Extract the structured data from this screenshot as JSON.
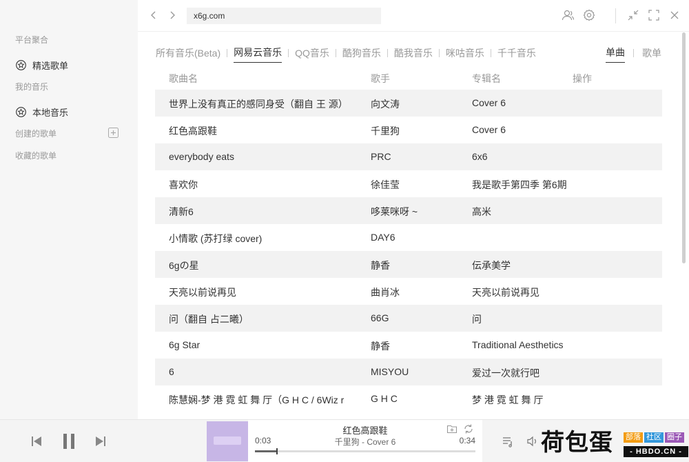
{
  "sidebar": {
    "platform_label": "平台聚合",
    "featured_label": "精选歌单",
    "my_music_label": "我的音乐",
    "local_label": "本地音乐",
    "created_label": "创建的歌单",
    "collected_label": "收藏的歌单"
  },
  "topbar": {
    "address": "x6g.com"
  },
  "tabs": [
    "所有音乐(Beta)",
    "网易云音乐",
    "QQ音乐",
    "酷狗音乐",
    "酷我音乐",
    "咪咕音乐",
    "千千音乐"
  ],
  "active_tab": "网易云音乐",
  "right_tabs": [
    "单曲",
    "歌单"
  ],
  "table": {
    "headers": {
      "name": "歌曲名",
      "artist": "歌手",
      "album": "专辑名",
      "action": "操作"
    },
    "rows": [
      {
        "name": "世界上没有真正的感同身受（翻自 王 源）",
        "artist": "向文涛",
        "album": "Cover 6"
      },
      {
        "name": "红色高跟鞋",
        "artist": "千里狗",
        "album": "Cover 6"
      },
      {
        "name": "everybody eats",
        "artist": "PRC",
        "album": "6x6"
      },
      {
        "name": "喜欢你",
        "artist": "徐佳莹",
        "album": "我是歌手第四季 第6期"
      },
      {
        "name": "清新6",
        "artist": "哆莱咪呀 ~",
        "album": "高米"
      },
      {
        "name": "小情歌 (苏打绿 cover)",
        "artist": "DAY6",
        "album": ""
      },
      {
        "name": "6gの星",
        "artist": "静香",
        "album": "伝承美学"
      },
      {
        "name": "天亮以前说再见",
        "artist": "曲肖冰",
        "album": "天亮以前说再见"
      },
      {
        "name": "问（翻自 占二曦）",
        "artist": "66G",
        "album": "问"
      },
      {
        "name": "6g Star",
        "artist": "静香",
        "album": "Traditional Aesthetics"
      },
      {
        "name": "6",
        "artist": "MISYOU",
        "album": "爱过一次就行吧"
      },
      {
        "name": "陈慧娴-梦 港 霓 虹 舞 厅（G H C / 6Wiz r",
        "artist": "G H C",
        "album": "梦 港 霓 虹 舞 厅"
      }
    ]
  },
  "player": {
    "title": "红色高跟鞋",
    "subtitle": "千里狗 - Cover 6",
    "current_time": "0:03",
    "total_time": "0:34",
    "progress_fraction": 0.1
  },
  "watermark": {
    "brand": "荷包蛋",
    "tags": [
      "部落",
      "社区",
      "圈子"
    ],
    "tag_colors": [
      "#f39c12",
      "#3498db",
      "#9b59b6"
    ],
    "url": "- HBDO.CN -"
  }
}
